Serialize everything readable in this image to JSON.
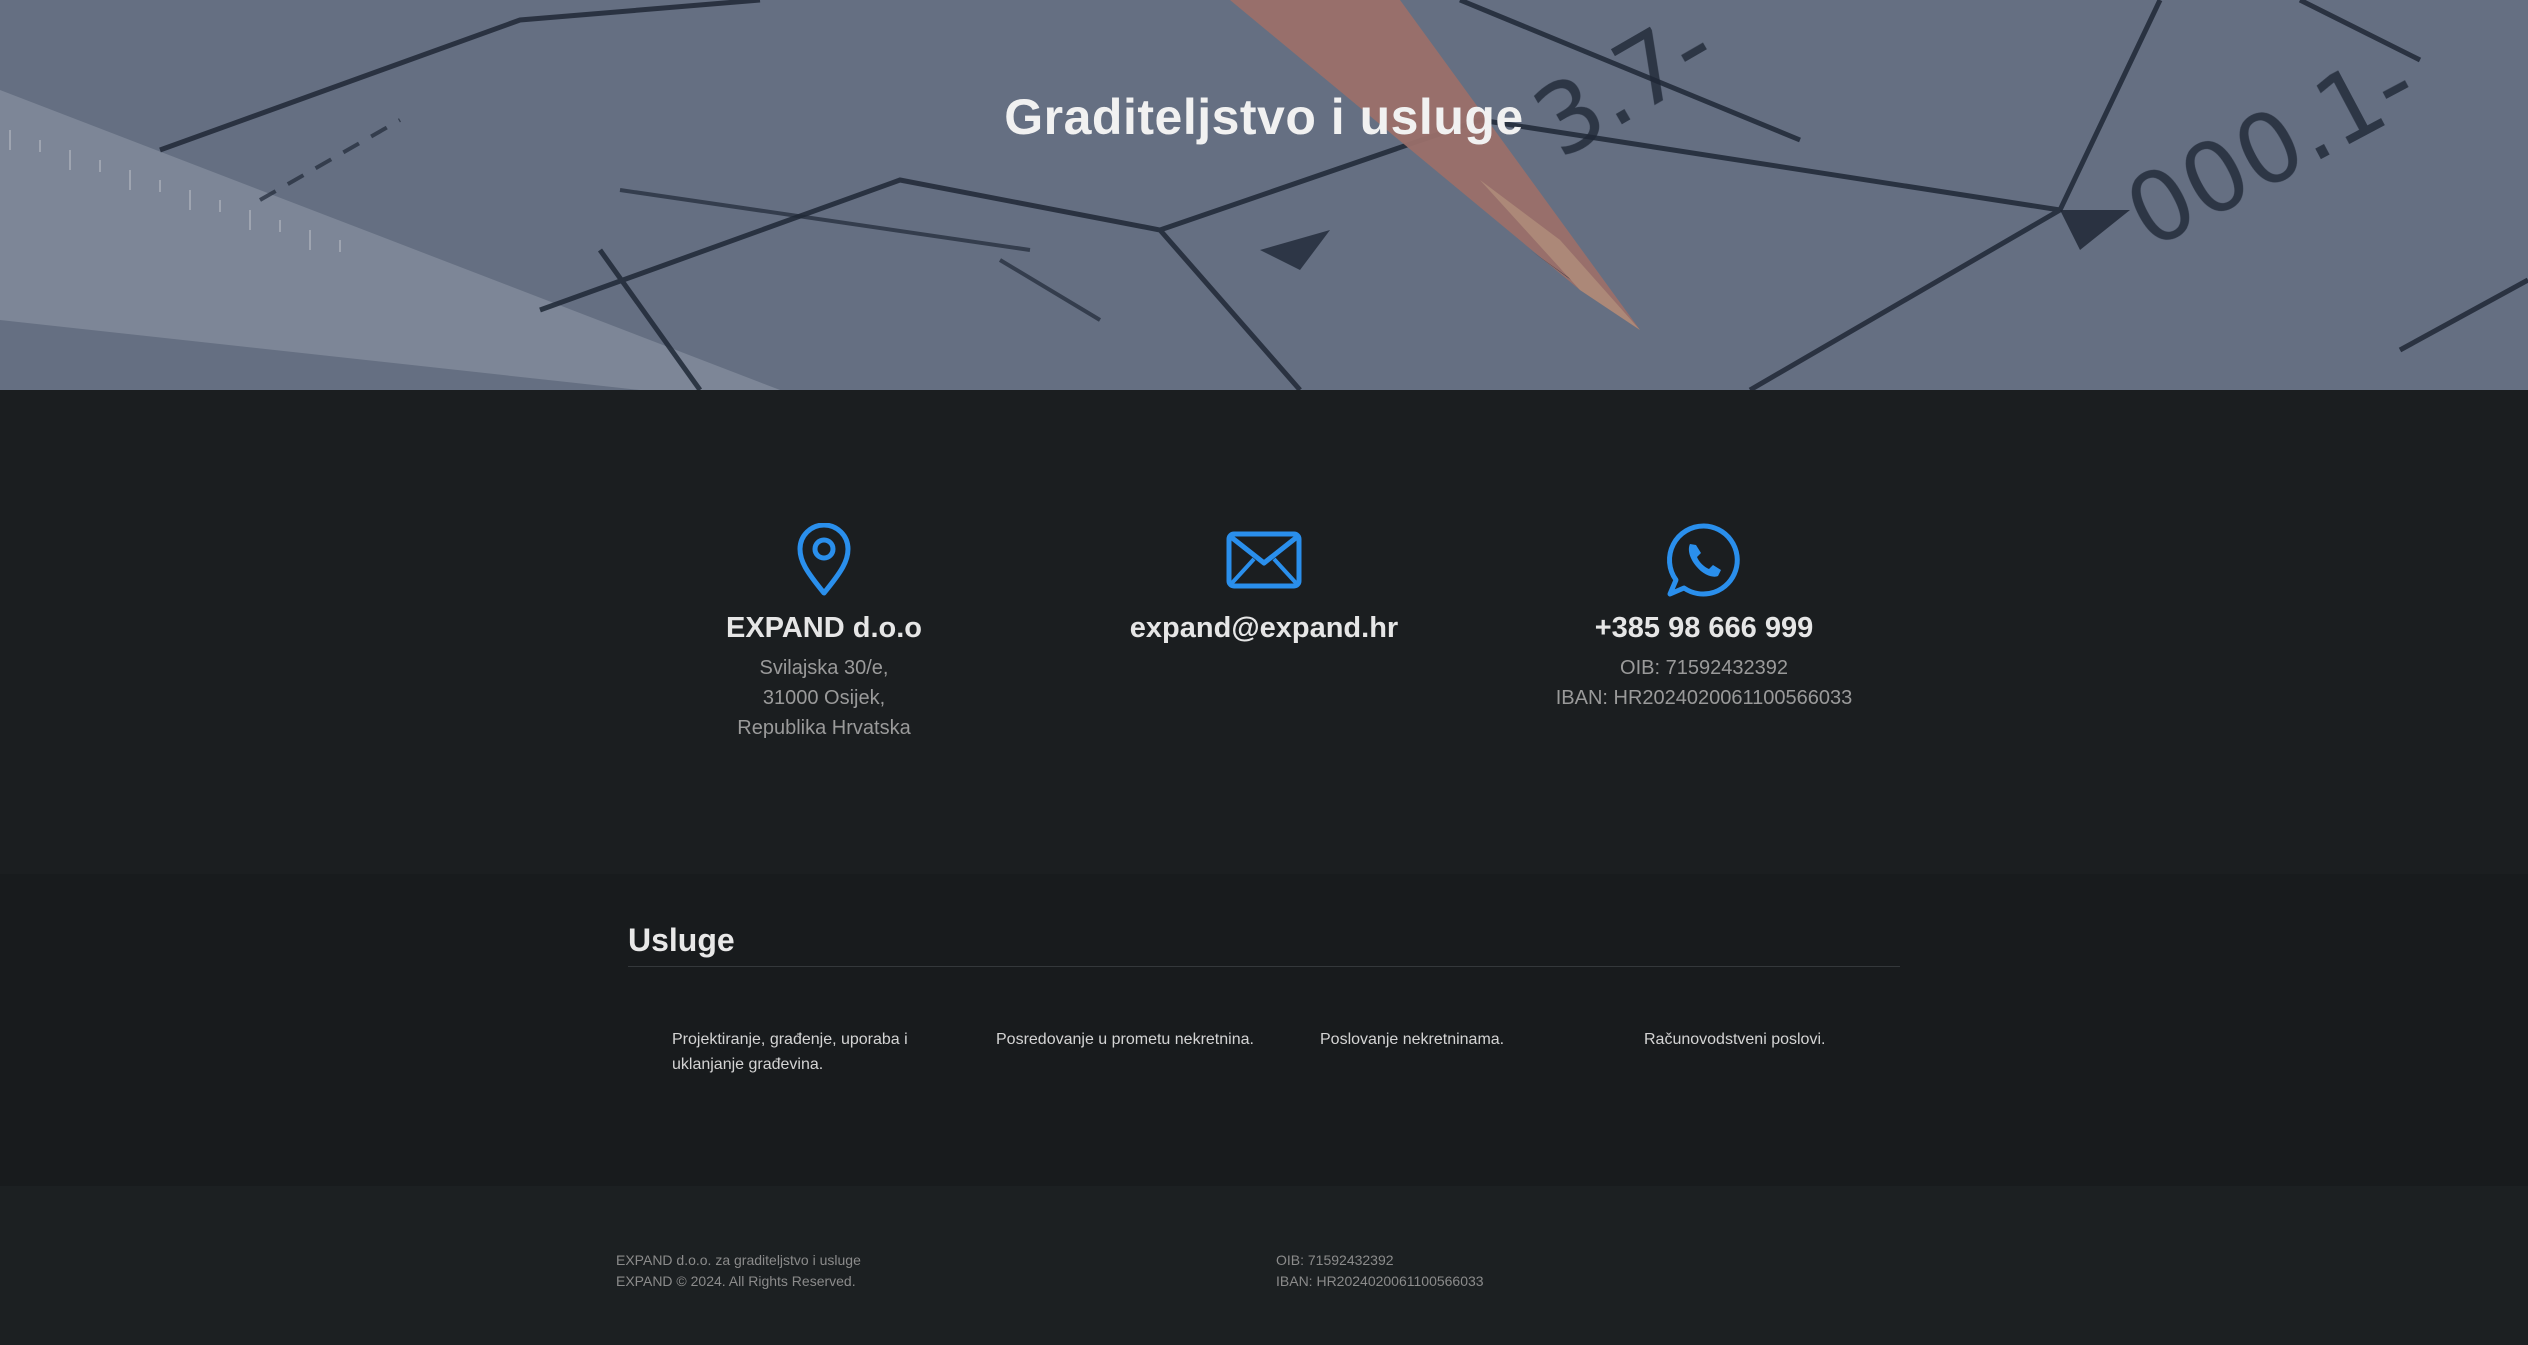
{
  "hero": {
    "title": "Graditeljstvo i usluge"
  },
  "contact": {
    "company": {
      "icon": "map-pin-icon",
      "name": "EXPAND d.o.o",
      "address": [
        "Svilajska 30/e,",
        "31000 Osijek,",
        "Republika Hrvatska"
      ]
    },
    "email": {
      "icon": "envelope-icon",
      "address": "expand@expand.hr"
    },
    "phone": {
      "icon": "whatsapp-icon",
      "number": "+385 98 666 999",
      "oib": "OIB: 71592432392",
      "iban": "IBAN: HR2024020061100566033"
    },
    "accent": "#2a8fec"
  },
  "services": {
    "title": "Usluge",
    "items": [
      "Projektiranje, građenje, uporaba i uklanjanje građevina.",
      "Posredovanje u prometu nekretnina.",
      "Poslovanje nekretninama.",
      "Računovodstveni poslovi."
    ]
  },
  "footer": {
    "left": [
      "EXPAND d.o.o. za graditeljstvo i usluge",
      "EXPAND © 2024. All Rights Reserved."
    ],
    "right": [
      "OIB: 71592432392",
      "IBAN: HR2024020061100566033"
    ]
  }
}
